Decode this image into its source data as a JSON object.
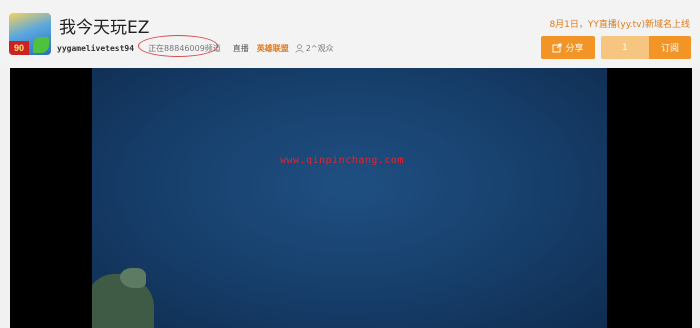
{
  "header": {
    "title": "我今天玩EZ",
    "username": "yygamelivetest94",
    "viewing_text": "正在88846009频道",
    "live_label": "直播",
    "category": "英雄联盟",
    "viewers": "2^观众",
    "announcement": "8月1日，YY直播(yy.tv)新域名上线",
    "share_label": "分享",
    "subscribe_count": "1",
    "subscribe_label": "订阅"
  },
  "video": {
    "watermark": "www.qinpinchang.com"
  },
  "colors": {
    "accent": "#f29526",
    "accent_light": "#f6c680",
    "category_text": "#e07a1b",
    "watermark_red": "#e8222a",
    "annotation_circle": "#d64a4a"
  }
}
